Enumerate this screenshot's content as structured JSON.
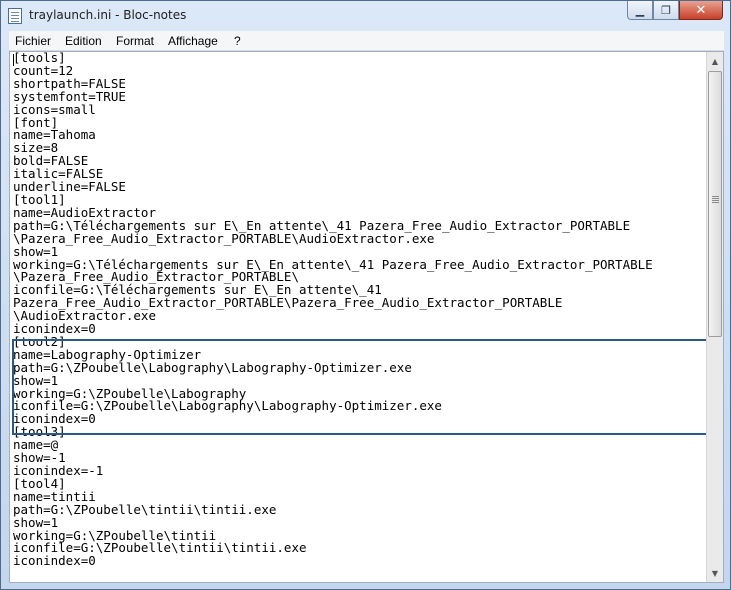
{
  "window": {
    "title": "traylaunch.ini - Bloc-notes"
  },
  "controls": {
    "minimize": "▁",
    "maximize": "❐",
    "close": "✕"
  },
  "icons": {
    "app": "notepad-icon",
    "scroll_up": "scroll-up-arrow-icon",
    "scroll_down": "scroll-down-arrow-icon"
  },
  "menu": [
    "Fichier",
    "Edition",
    "Format",
    "Affichage",
    "?"
  ],
  "editor": {
    "content": "[tools]\ncount=12\nshortpath=FALSE\nsystemfont=TRUE\nicons=small\n[font]\nname=Tahoma\nsize=8\nbold=FALSE\nitalic=FALSE\nunderline=FALSE\n[tool1]\nname=AudioExtractor\npath=G:\\Téléchargements sur E\\_En attente\\_41 Pazera_Free_Audio_Extractor_PORTABLE\n\\Pazera_Free_Audio_Extractor_PORTABLE\\AudioExtractor.exe\nshow=1\nworking=G:\\Téléchargements sur E\\_En attente\\_41 Pazera_Free_Audio_Extractor_PORTABLE\n\\Pazera_Free_Audio_Extractor_PORTABLE\\\niconfile=G:\\Téléchargements sur E\\_En attente\\_41\nPazera_Free_Audio_Extractor_PORTABLE\\Pazera_Free_Audio_Extractor_PORTABLE\n\\AudioExtractor.exe\niconindex=0\n[tool2]\nname=Labography-Optimizer\npath=G:\\ZPoubelle\\Labography\\Labography-Optimizer.exe\nshow=1\nworking=G:\\ZPoubelle\\Labography\niconfile=G:\\ZPoubelle\\Labography\\Labography-Optimizer.exe\niconindex=0\n[tool3]\nname=@\nshow=-1\niconindex=-1\n[tool4]\nname=tintii\npath=G:\\ZPoubelle\\tintii\\tintii.exe\nshow=1\nworking=G:\\ZPoubelle\\tintii\niconfile=G:\\ZPoubelle\\tintii\\tintii.exe\niconindex=0"
  },
  "colors": {
    "highlight_border": "#2c5a86",
    "close_button": "#c7402a"
  }
}
